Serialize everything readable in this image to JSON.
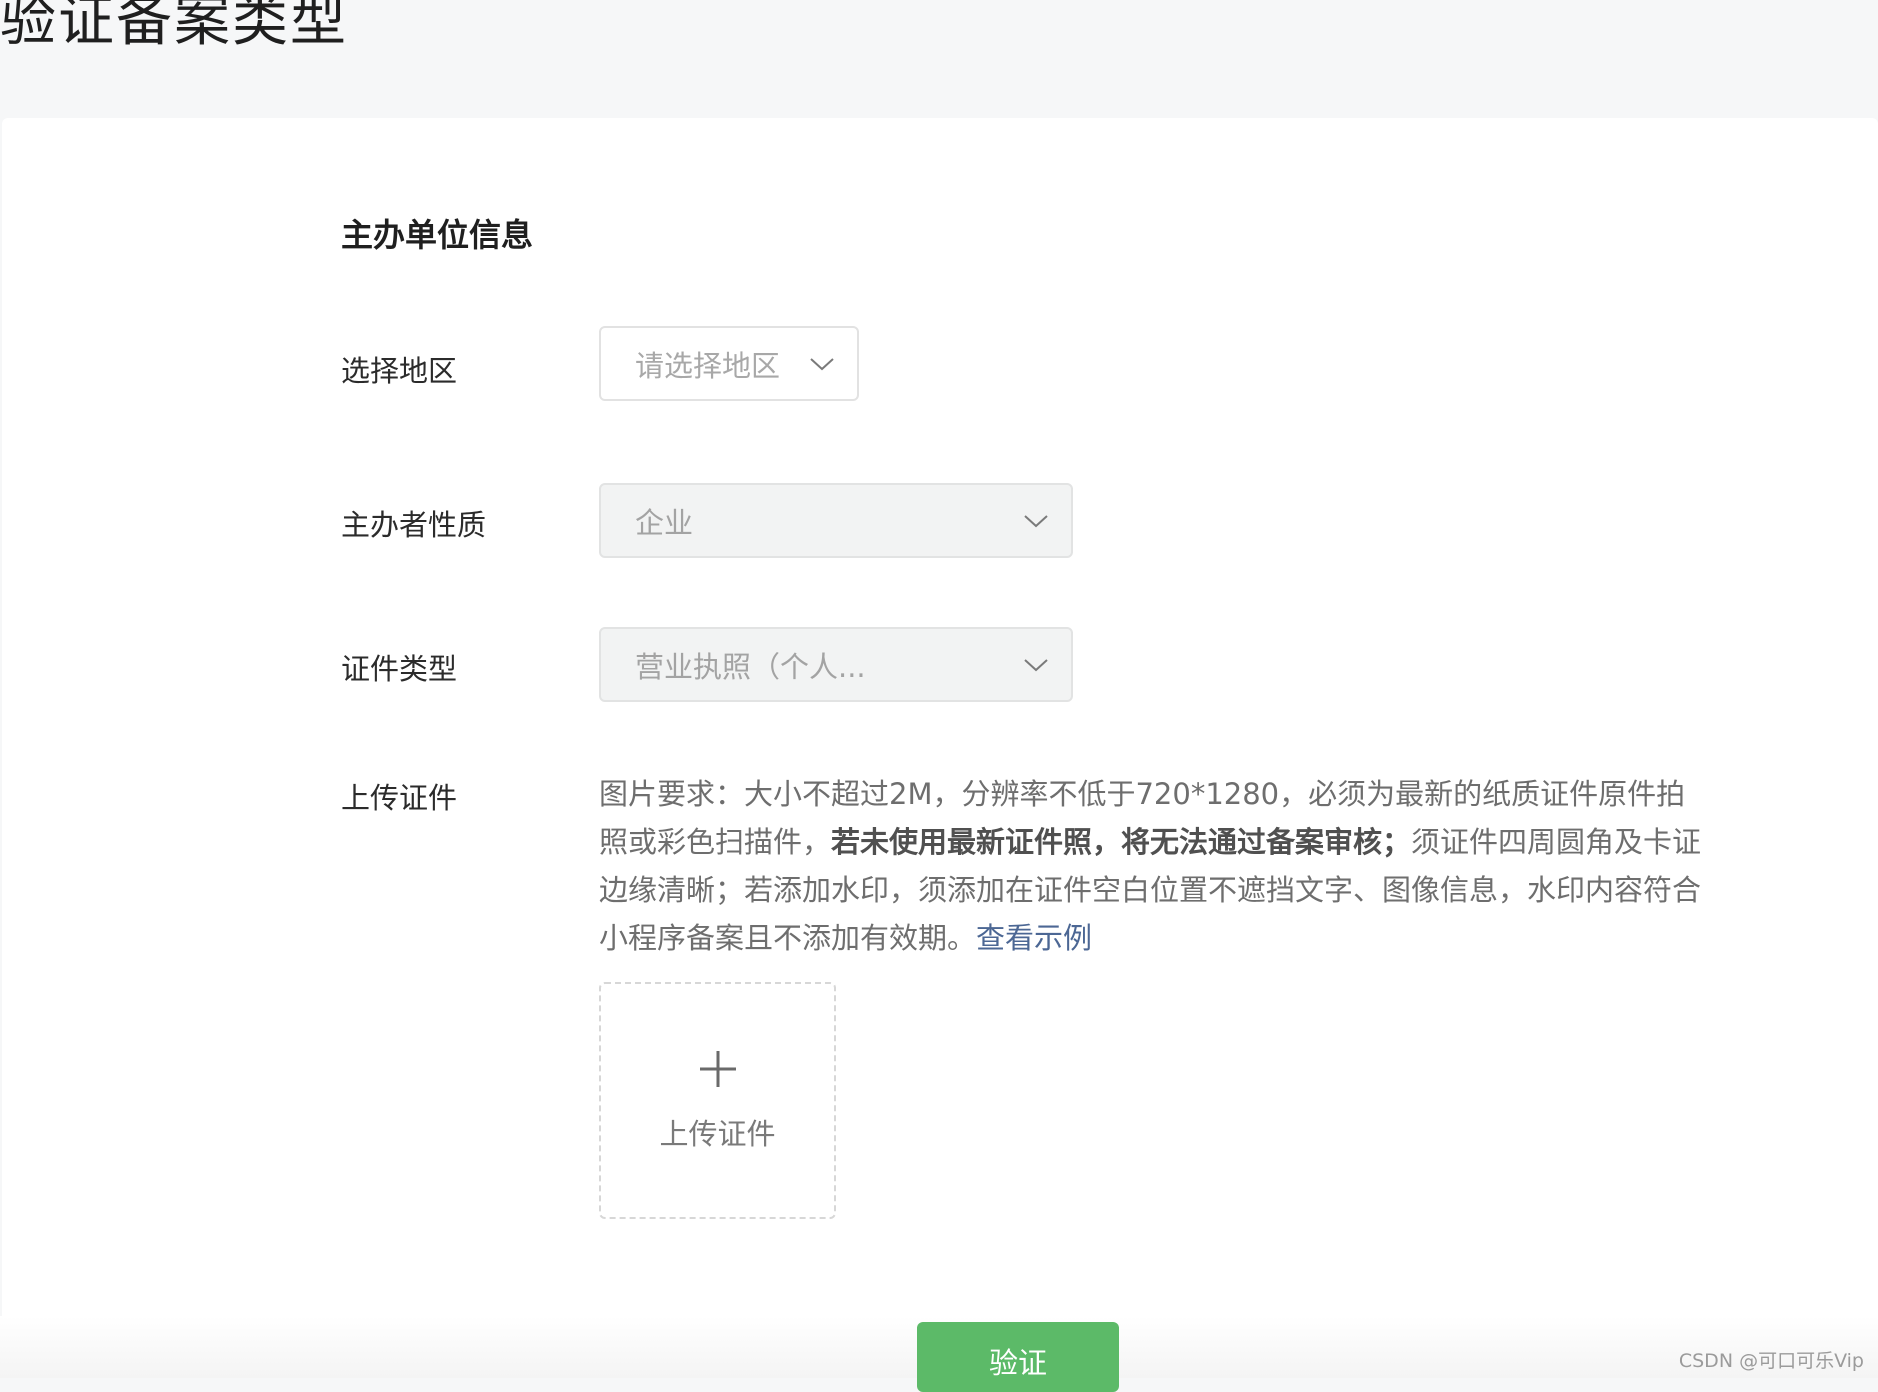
{
  "page": {
    "title": "验证备案类型"
  },
  "section": {
    "title": "主办单位信息"
  },
  "form": {
    "region": {
      "label": "选择地区",
      "placeholder": "请选择地区"
    },
    "organizer_type": {
      "label": "主办者性质",
      "value": "企业"
    },
    "certificate_type": {
      "label": "证件类型",
      "value": "营业执照（个人..."
    },
    "upload": {
      "label": "上传证件",
      "requirement_part1": "图片要求：大小不超过2M，分辨率不低于720*1280，必须为最新的纸质证件原件拍照或彩色扫描件，",
      "requirement_bold": "若未使用最新证件照，将无法通过备案审核；",
      "requirement_part2": "须证件四周圆角及卡证边缘清晰；若添加水印，须添加在证件空白位置不遮挡文字、图像信息，水印内容符合小程序备案且不添加有效期。",
      "example_link": "查看示例",
      "button_label": "上传证件"
    }
  },
  "actions": {
    "verify_label": "验证"
  },
  "watermark": "CSDN @可口可乐Vip",
  "colors": {
    "primary": "#5cba68",
    "link": "#4c6794",
    "background": "#f6f7f8"
  },
  "icons": {
    "dropdown": "chevron-down-icon",
    "upload": "plus-icon"
  }
}
